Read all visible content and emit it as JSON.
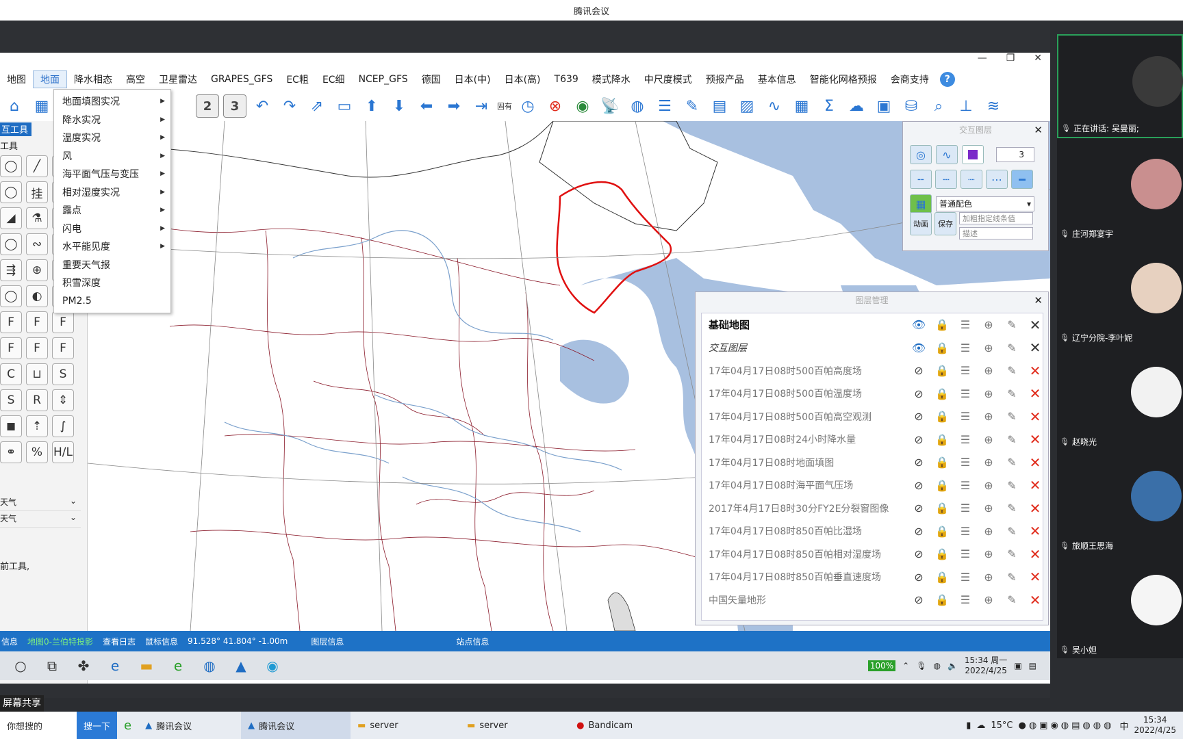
{
  "window_title": "腾讯会议",
  "app": {
    "win_controls": [
      "—",
      "❐",
      "✕"
    ],
    "menus": [
      "地图",
      "地面",
      "降水相态",
      "高空",
      "卫星雷达",
      "GRAPES_GFS",
      "EC粗",
      "EC细",
      "NCEP_GFS",
      "德国",
      "日本(中)",
      "日本(高)",
      "T639",
      "模式降水",
      "中尺度模式",
      "预报产品",
      "基本信息",
      "智能化网格预报",
      "会商支持"
    ],
    "active_menu": "地面",
    "help_label": "?",
    "toolbar_gutai": "固有",
    "dropdown": [
      {
        "label": "地面填图实况",
        "sub": true
      },
      {
        "label": "降水实况",
        "sub": true
      },
      {
        "label": "温度实况",
        "sub": true
      },
      {
        "label": "风",
        "sub": true
      },
      {
        "label": "海平面气压与变压",
        "sub": true
      },
      {
        "label": "相对湿度实况",
        "sub": true
      },
      {
        "label": "露点",
        "sub": true
      },
      {
        "label": "闪电",
        "sub": true
      },
      {
        "label": "水平能见度",
        "sub": true
      },
      {
        "label": "重要天气报",
        "sub": false
      },
      {
        "label": "积雪深度",
        "sub": false
      },
      {
        "label": "PM2.5",
        "sub": false
      }
    ],
    "left_panel": {
      "tab": "互工具",
      "head": "工具",
      "tools": [
        "◯",
        "╱",
        "◡",
        "◯",
        "挂",
        "◯",
        "◢",
        "⚗",
        "◯",
        "◯",
        "∾",
        "◯",
        "⇶",
        "⊕",
        "◯",
        "◯",
        "◐",
        "●",
        "F",
        "F",
        "F",
        "F",
        "F",
        "F",
        "C",
        "⊔",
        "S",
        "S",
        "R",
        "⇕",
        "◼",
        "⇡",
        "∫",
        "⚭",
        "%",
        "H/L"
      ],
      "row1": "天气",
      "row2": "天气",
      "note": "前工具,"
    },
    "interact_panel": {
      "title": "交互图层",
      "number": "3",
      "color_scheme": "普通配色",
      "btn_anim": "动画",
      "btn_save": "保存",
      "field_cond": "加粗指定线条值",
      "field_desc": "描述"
    },
    "layer_panel": {
      "title": "图层管理",
      "layers": [
        {
          "name": "基础地图",
          "style": "bold",
          "visible": true,
          "close": "dark"
        },
        {
          "name": "交互图层",
          "style": "italic",
          "visible": true,
          "close": "dark"
        },
        {
          "name": "17年04月17日08时500百帕高度场",
          "style": "",
          "visible": false,
          "close": "red"
        },
        {
          "name": "17年04月17日08时500百帕温度场",
          "style": "",
          "visible": false,
          "close": "red"
        },
        {
          "name": "17年04月17日08时500百帕高空观测",
          "style": "",
          "visible": false,
          "close": "red"
        },
        {
          "name": "17年04月17日08时24小时降水量",
          "style": "",
          "visible": false,
          "close": "red"
        },
        {
          "name": "17年04月17日08时地面填图",
          "style": "",
          "visible": false,
          "close": "red"
        },
        {
          "name": "17年04月17日08时海平面气压场",
          "style": "",
          "visible": false,
          "close": "red"
        },
        {
          "name": "2017年4月17日8时30分FY2E分裂窗图像",
          "style": "",
          "visible": false,
          "close": "red"
        },
        {
          "name": "17年04月17日08时850百帕比湿场",
          "style": "",
          "visible": false,
          "close": "red"
        },
        {
          "name": "17年04月17日08时850百帕相对湿度场",
          "style": "",
          "visible": false,
          "close": "red"
        },
        {
          "name": "17年04月17日08时850百帕垂直速度场",
          "style": "",
          "visible": false,
          "close": "red"
        },
        {
          "name": "中国矢量地形",
          "style": "",
          "visible": false,
          "close": "red"
        }
      ]
    },
    "status": {
      "info": "信息",
      "map_proj": "地图0-兰伯特投影",
      "log": "查看日志",
      "mouse_label": "鼠标信息",
      "coords": "91.528° 41.804° -1.00m",
      "layer_info": "图层信息",
      "station_info": "站点信息"
    },
    "guest_taskbar": {
      "battery": "100%",
      "time": "15:34 周一",
      "date": "2022/4/25"
    }
  },
  "share_label": "屏幕共享",
  "host_taskbar": {
    "search_placeholder": "你想搜的",
    "search_btn": "搜一下",
    "apps": [
      "腾讯会议",
      "腾讯会议",
      "server",
      "server",
      "Bandicam"
    ],
    "weather": "15°C",
    "ime": "中",
    "time": "15:34",
    "date": "2022/4/25"
  },
  "participants": [
    {
      "name": "正在讲话: 吴曼丽;",
      "speaking": true
    },
    {
      "name": "庄河郑宴宇"
    },
    {
      "name": "辽宁分院-李叶妮"
    },
    {
      "name": "赵晓光"
    },
    {
      "name": "旅顺王思海"
    },
    {
      "name": "吴小妲"
    }
  ],
  "colors": {
    "accent": "#1e72c6",
    "red_outline": "#e01010",
    "sea": "#a8c0e0"
  }
}
